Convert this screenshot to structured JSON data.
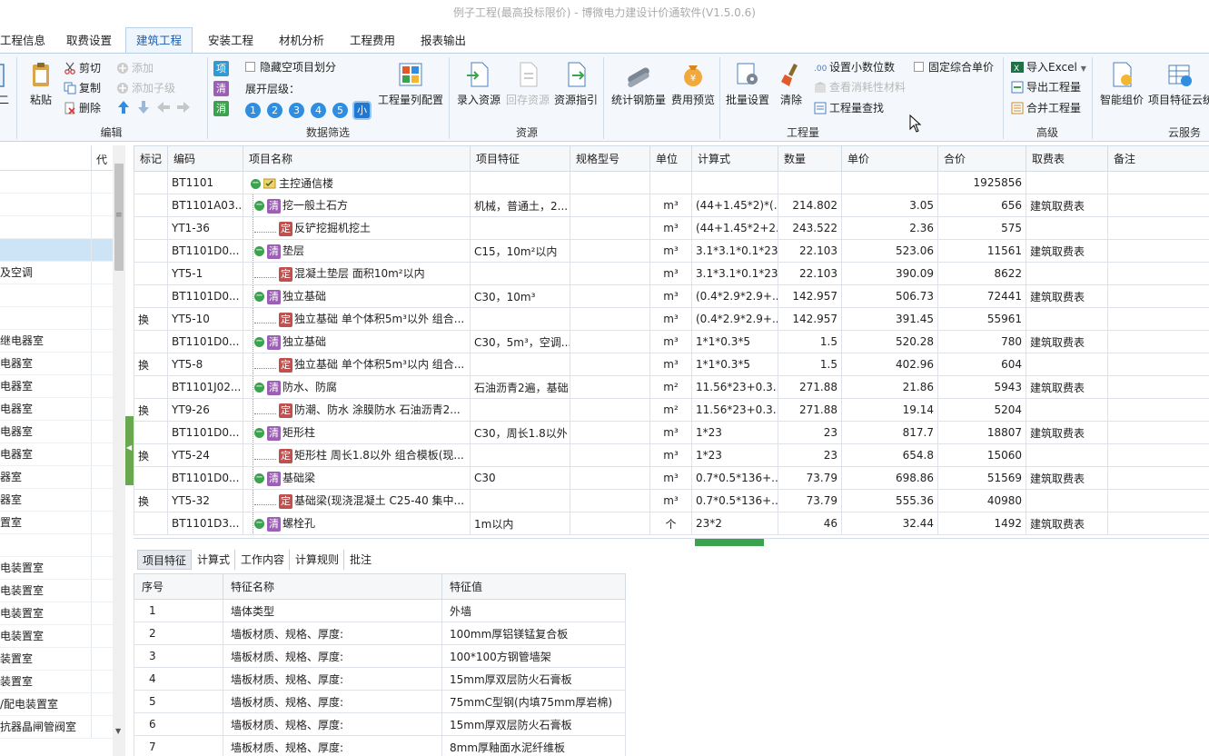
{
  "window": {
    "title": "例子工程(最高投标限价) - 博微电力建设计价通软件(V1.5.0.6)"
  },
  "menu": {
    "tabs": [
      "工程信息",
      "取费设置",
      "建筑工程",
      "安装工程",
      "材机分析",
      "工程费用",
      "报表输出"
    ],
    "active": "建筑工程"
  },
  "ribbon": {
    "left_partial": "二",
    "edit": {
      "title": "编辑",
      "paste": "粘贴",
      "cut": "剪切",
      "copy": "复制",
      "delete": "删除",
      "add": "添加",
      "add_child": "添加子级"
    },
    "filter": {
      "title": "数据筛选",
      "xiang": "项",
      "qing": "清",
      "xiao": "消",
      "hide_empty": "隐藏空项目划分",
      "expand_level": "展开层级：",
      "levels": [
        "1",
        "2",
        "3",
        "4",
        "5",
        "小"
      ],
      "qty_config": "工程量列配置"
    },
    "resource": {
      "title": "资源",
      "enter": "录入资源",
      "save": "回存资源",
      "guide": "资源指引"
    },
    "quantity": {
      "title": "工程量",
      "steel": "统计钢筋量",
      "preview": "费用预览",
      "batch": "批量设置",
      "clear": "清除",
      "decimals": "设置小数位数",
      "consumable": "查看消耗性材料",
      "find": "工程量查找",
      "fixed_price": "固定综合单价"
    },
    "advanced": {
      "title": "高级",
      "import_excel": "导入Excel",
      "export_qty": "导出工程量",
      "merge_qty": "合并工程量"
    },
    "cloud": {
      "title": "云服务",
      "smart": "智能组价",
      "feature": "项目特征云统"
    }
  },
  "left_tree": {
    "header_code": "代",
    "rows": [
      "",
      "",
      "",
      "",
      "及空调",
      "",
      "",
      "继电器室",
      "电器室",
      "电器室",
      "电器室",
      "电器室",
      "电器室",
      "器室",
      "器室",
      "置室",
      "",
      "电装置室",
      "电装置室",
      "电装置室",
      "电装置室",
      "装置室",
      "装置室",
      "/配电装置室",
      "抗器晶闸管阀室"
    ],
    "selected_index": 3
  },
  "grid": {
    "columns": [
      "标记",
      "编码",
      "项目名称",
      "项目特征",
      "规格型号",
      "单位",
      "计算式",
      "数量",
      "单价",
      "合价",
      "取费表",
      "备注"
    ],
    "rows": [
      {
        "mark": "",
        "code": "BT1101",
        "kind": "root",
        "name": "主控通信楼",
        "feature": "",
        "spec": "",
        "unit": "",
        "formula": "",
        "qty": "",
        "price": "",
        "total": "1925856",
        "fee": "",
        "note": ""
      },
      {
        "mark": "",
        "code": "BT1101A03...",
        "kind": "q",
        "name": "挖一般土石方",
        "feature": "机械，普通土，2...",
        "spec": "",
        "unit": "m³",
        "formula": "(44+1.45*2)*(...",
        "qty": "214.802",
        "price": "3.05",
        "total": "656",
        "fee": "建筑取费表",
        "note": ""
      },
      {
        "mark": "",
        "code": "YT1-36",
        "kind": "d",
        "name": "反铲挖掘机挖土",
        "feature": "",
        "spec": "",
        "unit": "m³",
        "formula": "(44+1.45*2+2...",
        "qty": "243.522",
        "price": "2.36",
        "total": "575",
        "fee": "",
        "note": ""
      },
      {
        "mark": "",
        "code": "BT1101D0...",
        "kind": "q",
        "name": "垫层",
        "feature": "C15，10m²以内",
        "spec": "",
        "unit": "m³",
        "formula": "3.1*3.1*0.1*23",
        "qty": "22.103",
        "price": "523.06",
        "total": "11561",
        "fee": "建筑取费表",
        "note": ""
      },
      {
        "mark": "",
        "code": "YT5-1",
        "kind": "d",
        "name": "混凝土垫层 面积10m²以内",
        "feature": "",
        "spec": "",
        "unit": "m³",
        "formula": "3.1*3.1*0.1*23",
        "qty": "22.103",
        "price": "390.09",
        "total": "8622",
        "fee": "",
        "note": ""
      },
      {
        "mark": "",
        "code": "BT1101D0...",
        "kind": "q",
        "name": "独立基础",
        "feature": "C30，10m³",
        "spec": "",
        "unit": "m³",
        "formula": "(0.4*2.9*2.9+...",
        "qty": "142.957",
        "price": "506.73",
        "total": "72441",
        "fee": "建筑取费表",
        "note": ""
      },
      {
        "mark": "换",
        "code": "YT5-10",
        "kind": "d",
        "name": "独立基础 单个体积5m³以外 组合...",
        "feature": "",
        "spec": "",
        "unit": "m³",
        "formula": "(0.4*2.9*2.9+...",
        "qty": "142.957",
        "price": "391.45",
        "total": "55961",
        "fee": "",
        "note": ""
      },
      {
        "mark": "",
        "code": "BT1101D0...",
        "kind": "q",
        "name": "独立基础",
        "feature": "C30，5m³，空调...",
        "spec": "",
        "unit": "m³",
        "formula": "1*1*0.3*5",
        "qty": "1.5",
        "price": "520.28",
        "total": "780",
        "fee": "建筑取费表",
        "note": ""
      },
      {
        "mark": "换",
        "code": "YT5-8",
        "kind": "d",
        "name": "独立基础 单个体积5m³以内 组合...",
        "feature": "",
        "spec": "",
        "unit": "m³",
        "formula": "1*1*0.3*5",
        "qty": "1.5",
        "price": "402.96",
        "total": "604",
        "fee": "",
        "note": ""
      },
      {
        "mark": "",
        "code": "BT1101J02...",
        "kind": "q",
        "name": "防水、防腐",
        "feature": "石油沥青2遍，基础",
        "spec": "",
        "unit": "m²",
        "formula": "11.56*23+0.3...",
        "qty": "271.88",
        "price": "21.86",
        "total": "5943",
        "fee": "建筑取费表",
        "note": ""
      },
      {
        "mark": "换",
        "code": "YT9-26",
        "kind": "d",
        "name": "防潮、防水 涂膜防水 石油沥青2...",
        "feature": "",
        "spec": "",
        "unit": "m²",
        "formula": "11.56*23+0.3...",
        "qty": "271.88",
        "price": "19.14",
        "total": "5204",
        "fee": "",
        "note": ""
      },
      {
        "mark": "",
        "code": "BT1101D0...",
        "kind": "q",
        "name": "矩形柱",
        "feature": "C30，周长1.8以外",
        "spec": "",
        "unit": "m³",
        "formula": "1*23",
        "qty": "23",
        "price": "817.7",
        "total": "18807",
        "fee": "建筑取费表",
        "note": ""
      },
      {
        "mark": "换",
        "code": "YT5-24",
        "kind": "d",
        "name": "矩形柱 周长1.8以外 组合模板(现...",
        "feature": "",
        "spec": "",
        "unit": "m³",
        "formula": "1*23",
        "qty": "23",
        "price": "654.8",
        "total": "15060",
        "fee": "",
        "note": ""
      },
      {
        "mark": "",
        "code": "BT1101D0...",
        "kind": "q",
        "name": "基础梁",
        "feature": "C30",
        "spec": "",
        "unit": "m³",
        "formula": "0.7*0.5*136+...",
        "qty": "73.79",
        "price": "698.86",
        "total": "51569",
        "fee": "建筑取费表",
        "note": ""
      },
      {
        "mark": "换",
        "code": "YT5-32",
        "kind": "d",
        "name": "基础梁(现浇混凝土 C25-40 集中...",
        "feature": "",
        "spec": "",
        "unit": "m³",
        "formula": "0.7*0.5*136+...",
        "qty": "73.79",
        "price": "555.36",
        "total": "40980",
        "fee": "",
        "note": ""
      },
      {
        "mark": "",
        "code": "BT1101D3...",
        "kind": "q",
        "name": "螺栓孔",
        "feature": "1m以内",
        "spec": "",
        "unit": "个",
        "formula": "23*2",
        "qty": "46",
        "price": "32.44",
        "total": "1492",
        "fee": "建筑取费表",
        "note": ""
      }
    ],
    "tag_q": "清",
    "tag_d": "定"
  },
  "bottom_tabs": [
    "项目特征",
    "计算式",
    "工作内容",
    "计算规则",
    "批注"
  ],
  "features": {
    "columns": [
      "序号",
      "特征名称",
      "特征值"
    ],
    "rows": [
      {
        "no": "1",
        "name": "墙体类型",
        "value": "外墙"
      },
      {
        "no": "2",
        "name": "墙板材质、规格、厚度:",
        "value": "100mm厚铝镁锰复合板"
      },
      {
        "no": "3",
        "name": "墙板材质、规格、厚度:",
        "value": "100*100方钢管墙架"
      },
      {
        "no": "4",
        "name": "墙板材质、规格、厚度:",
        "value": "15mm厚双层防火石膏板"
      },
      {
        "no": "5",
        "name": "墙板材质、规格、厚度:",
        "value": "75mmC型钢(内填75mm厚岩棉)"
      },
      {
        "no": "6",
        "name": "墙板材质、规格、厚度:",
        "value": "15mm厚双层防火石膏板"
      },
      {
        "no": "7",
        "name": "墙板材质、规格、厚度:",
        "value": "8mm厚釉面水泥纤维板"
      }
    ]
  },
  "colors": {
    "accent": "#1f78d1",
    "tag_q": "#9c5fb5",
    "tag_d": "#c0504d",
    "tree_green": "#3ba34d"
  }
}
